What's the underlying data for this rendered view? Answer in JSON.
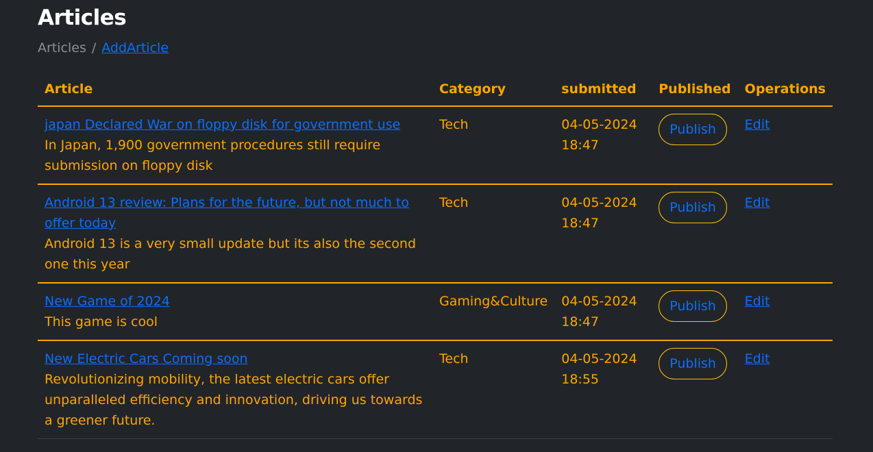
{
  "page": {
    "title": "Articles"
  },
  "breadcrumb": {
    "current": "Articles",
    "separator": "/",
    "link": "AddArticle"
  },
  "table": {
    "headers": {
      "article": "Article",
      "category": "Category",
      "submitted": "submitted",
      "published": "Published",
      "operations": "Operations"
    },
    "rows": [
      {
        "title": "japan Declared War on floppy disk for government use",
        "summary": "In Japan, 1,900 government procedures still require submission on floppy disk",
        "category": "Tech",
        "date": "04-05-2024",
        "time": "18:47",
        "publish_label": "Publish",
        "edit_label": "Edit"
      },
      {
        "title": "Android 13 review: Plans for the future, but not much to offer today",
        "summary": "Android 13 is a very small update but its also the second one this year",
        "category": "Tech",
        "date": "04-05-2024",
        "time": "18:47",
        "publish_label": "Publish",
        "edit_label": "Edit"
      },
      {
        "title": "New Game of 2024",
        "summary": "This game is cool",
        "category": "Gaming&Culture",
        "date": "04-05-2024",
        "time": "18:47",
        "publish_label": "Publish",
        "edit_label": "Edit"
      },
      {
        "title": "New Electric Cars Coming soon",
        "summary": "Revolutionizing mobility, the latest electric cars offer unparalleled efficiency and innovation, driving us towards a greener future.",
        "category": "Tech",
        "date": "04-05-2024",
        "time": "18:55",
        "publish_label": "Publish",
        "edit_label": "Edit"
      }
    ]
  },
  "colors": {
    "background": "#212529",
    "accent": "#ffa500",
    "link": "#0d6efd",
    "button_border": "#ffc107",
    "heading": "#ffffff",
    "muted": "#8a9096"
  }
}
